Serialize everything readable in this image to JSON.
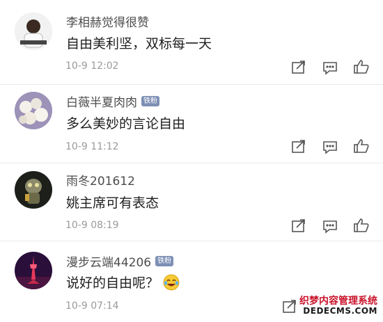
{
  "comments": [
    {
      "username": "李相赫觉得很赞",
      "badge": "",
      "text": "自由美利坚，双标每一天",
      "time": "10-9 12:02"
    },
    {
      "username": "白薇半夏肉肉",
      "badge": "铁粉",
      "text": "多么美妙的言论自由",
      "time": "10-9 11:12"
    },
    {
      "username": "雨冬201612",
      "badge": "",
      "text": "姚主席可有表态",
      "time": "10-9 08:19"
    },
    {
      "username": "漫步云端44206",
      "badge": "铁粉",
      "text": "说好的自由呢？",
      "time": "10-9 07:14",
      "emoji": "laughing-crying-emoji"
    }
  ],
  "actions": {
    "repost_icon": "repost-icon",
    "comment_icon": "comment-icon",
    "like_icon": "like-icon"
  },
  "watermark": {
    "title": "织梦内容管理系统",
    "domain": "DEDECMS.COM"
  },
  "colors": {
    "username": "#4d4d4d",
    "text": "#1e1e1e",
    "time": "#9a9a9a",
    "badge": "#7d8fb5",
    "watermark": "#c9132a"
  }
}
